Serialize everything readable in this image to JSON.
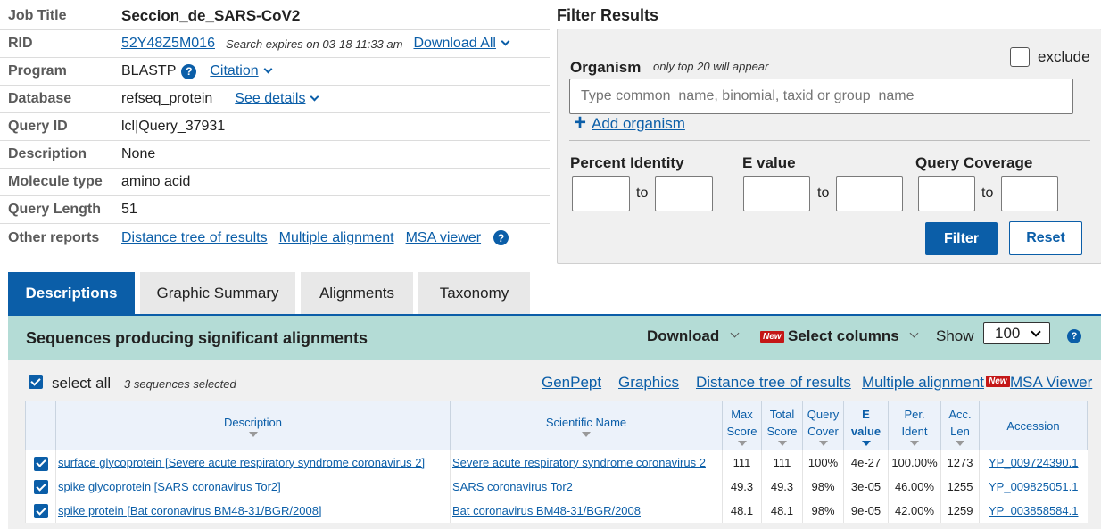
{
  "job": {
    "rows": [
      {
        "label": "Job Title",
        "value": "Seccion_de_SARS-CoV2"
      },
      {
        "label": "RID",
        "value": "52Y48Z5M016",
        "expires": "Search expires on 03-18 11:33 am",
        "download_all": "Download All"
      },
      {
        "label": "Program",
        "value": "BLASTP",
        "citation": "Citation"
      },
      {
        "label": "Database",
        "value": "refseq_protein",
        "see_details": "See details"
      },
      {
        "label": "Query ID",
        "value": "lcl|Query_37931"
      },
      {
        "label": "Description",
        "value": "None"
      },
      {
        "label": "Molecule type",
        "value": "amino acid"
      },
      {
        "label": "Query Length",
        "value": "51"
      },
      {
        "label": "Other reports",
        "links": [
          "Distance tree of results",
          "Multiple alignment",
          "MSA viewer"
        ]
      }
    ]
  },
  "filter": {
    "title": "Filter Results",
    "organism_label": "Organism",
    "organism_note": "only top 20 will appear",
    "exclude_label": "exclude",
    "organism_placeholder": "Type common  name, binomial, taxid or group  name",
    "add_organism": "Add organism",
    "percent_identity_label": "Percent Identity",
    "evalue_label": "E value",
    "query_coverage_label": "Query Coverage",
    "to_label": "to",
    "filter_button": "Filter",
    "reset_button": "Reset"
  },
  "tabs": [
    "Descriptions",
    "Graphic Summary",
    "Alignments",
    "Taxonomy"
  ],
  "results": {
    "title": "Sequences producing significant alignments",
    "download": "Download",
    "new_badge": "New",
    "select_columns": "Select columns",
    "show_label": "Show",
    "show_value": "100",
    "select_all": "select all",
    "selected_count": "3 sequences selected",
    "toolbar_links": [
      "GenPept",
      "Graphics",
      "Distance tree of results",
      "Multiple alignment"
    ],
    "msa_viewer": "MSA Viewer",
    "columns": {
      "description": "Description",
      "scientific_name": "Scientific Name",
      "max_score": [
        "Max",
        "Score"
      ],
      "total_score": [
        "Total",
        "Score"
      ],
      "query_cover": [
        "Query",
        "Cover"
      ],
      "e_value": [
        "E",
        "value"
      ],
      "per_ident": [
        "Per.",
        "Ident"
      ],
      "acc_len": [
        "Acc.",
        "Len"
      ],
      "accession": "Accession"
    },
    "rows": [
      {
        "description": "surface glycoprotein [Severe acute respiratory syndrome coronavirus 2]",
        "scientific_name": "Severe acute respiratory syndrome coronavirus 2",
        "max_score": "111",
        "total_score": "111",
        "query_cover": "100%",
        "e_value": "4e-27",
        "per_ident": "100.00%",
        "acc_len": "1273",
        "accession": "YP_009724390.1"
      },
      {
        "description": "spike glycoprotein [SARS coronavirus Tor2]",
        "scientific_name": "SARS coronavirus Tor2",
        "max_score": "49.3",
        "total_score": "49.3",
        "query_cover": "98%",
        "e_value": "3e-05",
        "per_ident": "46.00%",
        "acc_len": "1255",
        "accession": "YP_009825051.1"
      },
      {
        "description": "spike protein [Bat coronavirus BM48-31/BGR/2008]",
        "scientific_name": "Bat coronavirus BM48-31/BGR/2008",
        "max_score": "48.1",
        "total_score": "48.1",
        "query_cover": "98%",
        "e_value": "9e-05",
        "per_ident": "42.00%",
        "acc_len": "1259",
        "accession": "YP_003858584.1"
      }
    ]
  },
  "colors": {
    "primary": "#0b5ea8",
    "teal_header": "#b4dcd6",
    "new_badge": "#c41717",
    "panel_bg": "#f0f0f0"
  }
}
